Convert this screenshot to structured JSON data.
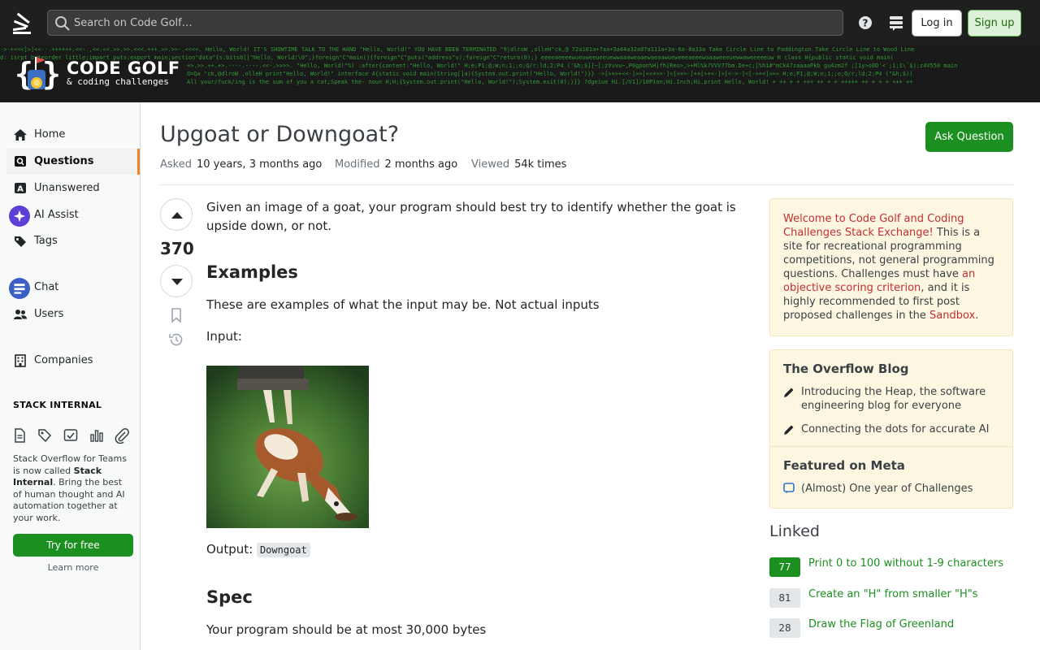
{
  "header": {
    "search_placeholder": "Search on Code Golf…",
    "login_label": "Log in",
    "signup_label": "Sign up"
  },
  "banner": {
    "site_name": "CODE GOLF",
    "site_sub": "& coding challenges",
    "code_lines": [
      "->-+<<<]>]<<--.++++++.<<-.,<<.<<.>>.>>.<<<.+++.>>.>>-.<<<<. Hello, World! IT'S SHOWTIME TALK TO THE HAND \"Hello, World!\" YOU HAVE BEEN TERMINATED \"9|dlroW ,olleH\"ck,@ 72a101a+7aa+3a44a32a87a111a+3a-6a-8a33a Take Circle Line to Paddington Take Circle Line to Wood Line",
      "d: isrpt byteorder little;import puts;export main;section\"data\"{s:bits8[]\"Hello, World!\\0\";}foreign\"C\"main(){foreign\"C\"puts(\"address\"s);foreign\"C\"return(0);} eeeeaeeeewueuweeueeuewwaaaweaaewaeaawueweeeaeeewaaaweeeuewwaweeeeeuw H class H{public static void main(",
      "+>.>>.++.+>.----.----.<<-.>>>>. \"Hello, World!\"%) :after{content:\"Hello, World!\" H;e;P1;@;W;n;1;;o;Q/r;ld;2;P4 ('&h;$]]~[;zVvvu~,P0gpon%H]fh[Reo>,>+Ml%k?VVV?7bm.De+c;[%h1#\"mCkA7zaaaaPkb gu4zm2f ;[1y>o0D'<`;1;1\\`$);z4V550 main",
      "O=Qa \"ck,@dlroW ,olleH print\"Hello, World!\" interface A{static void main(String[]a){System.out.print(\"Hello, World!\")}} ->[>+>+<<-]>>[<<+>>-]<[<+>-]++[>+<-]>[<->-]<[->+<]>>> H;e;P1;@;W;n;1;;o;Q/r;ld;2;P4 (\"&h;$))",
      "All your/fuck/ing is the sum of you a cat;Speak the- noun H;H;{System.out.print(\"Hello, World!\");System.exit(0);}}} ?dgeiue Hi.[/V1]/10Pinn;Hi.Inch;Hi.print Hello, World! + ++ + + +++ ++ + + +++++ ++ + + + +++ ++"
    ]
  },
  "sidebar": {
    "items": [
      {
        "label": "Home"
      },
      {
        "label": "Questions"
      },
      {
        "label": "Unanswered"
      },
      {
        "label": "AI Assist"
      },
      {
        "label": "Tags"
      },
      {
        "label": "Chat"
      },
      {
        "label": "Users"
      },
      {
        "label": "Companies"
      }
    ],
    "stack_internal_title": "STACK INTERNAL",
    "si_text_1": "Stack Overflow for Teams is now called ",
    "si_text_bold_1": "Stack Internal",
    "si_text_2": ". Bring the best of human thought and AI automation together at your work.",
    "try_label": "Try for free",
    "learn_more_label": "Learn more"
  },
  "question": {
    "title": "Upgoat or Downgoat?",
    "ask_label": "Ask Question",
    "asked_key": "Asked",
    "asked_val": "10 years, 3 months ago",
    "modified_key": "Modified",
    "modified_val": "2 months ago",
    "viewed_key": "Viewed",
    "viewed_val": "54k times",
    "votes": "370",
    "p1": "Given an image of a goat, your program should best try to identify whether the goat is upside down, or not.",
    "h_examples": "Examples",
    "p2": "These are examples of what the input may be. Not actual inputs",
    "p3": "Input:",
    "p4_prefix": "Output:",
    "p4_code": "Downgoat",
    "h_spec": "Spec",
    "p5": "Your program should be at most 30,000 bytes"
  },
  "welcome": {
    "lnk1": "Welcome to Code Golf and Coding Challenges Stack Exchange!",
    "t1": " This is a site for recreational programming competitions, not general programming questions. Challenges must have ",
    "lnk2": "an objective scoring criterion",
    "t2": ", and it is highly recommended to first post proposed challenges in the ",
    "lnk3": "Sandbox",
    "t3": "."
  },
  "blog": {
    "title": "The Overflow Blog",
    "item1": "Introducing the Heap, the software engineering blog for everyone",
    "item2": "Connecting the dots for accurate AI",
    "meta_title": "Featured on Meta",
    "meta_item1": "(Almost) One year of Challenges"
  },
  "linked": {
    "title": "Linked",
    "items": [
      {
        "score": "77",
        "text": "Print 0 to 100 without 1-9 characters"
      },
      {
        "score": "81",
        "text": "Create an \"H\" from smaller \"H\"s"
      },
      {
        "score": "28",
        "text": "Draw the Flag of Greenland"
      }
    ]
  },
  "colors": {
    "accent": "#f48225",
    "green": "#1b8f1f",
    "link_red": "#c22e32",
    "notice_bg": "#fdf7e2"
  }
}
